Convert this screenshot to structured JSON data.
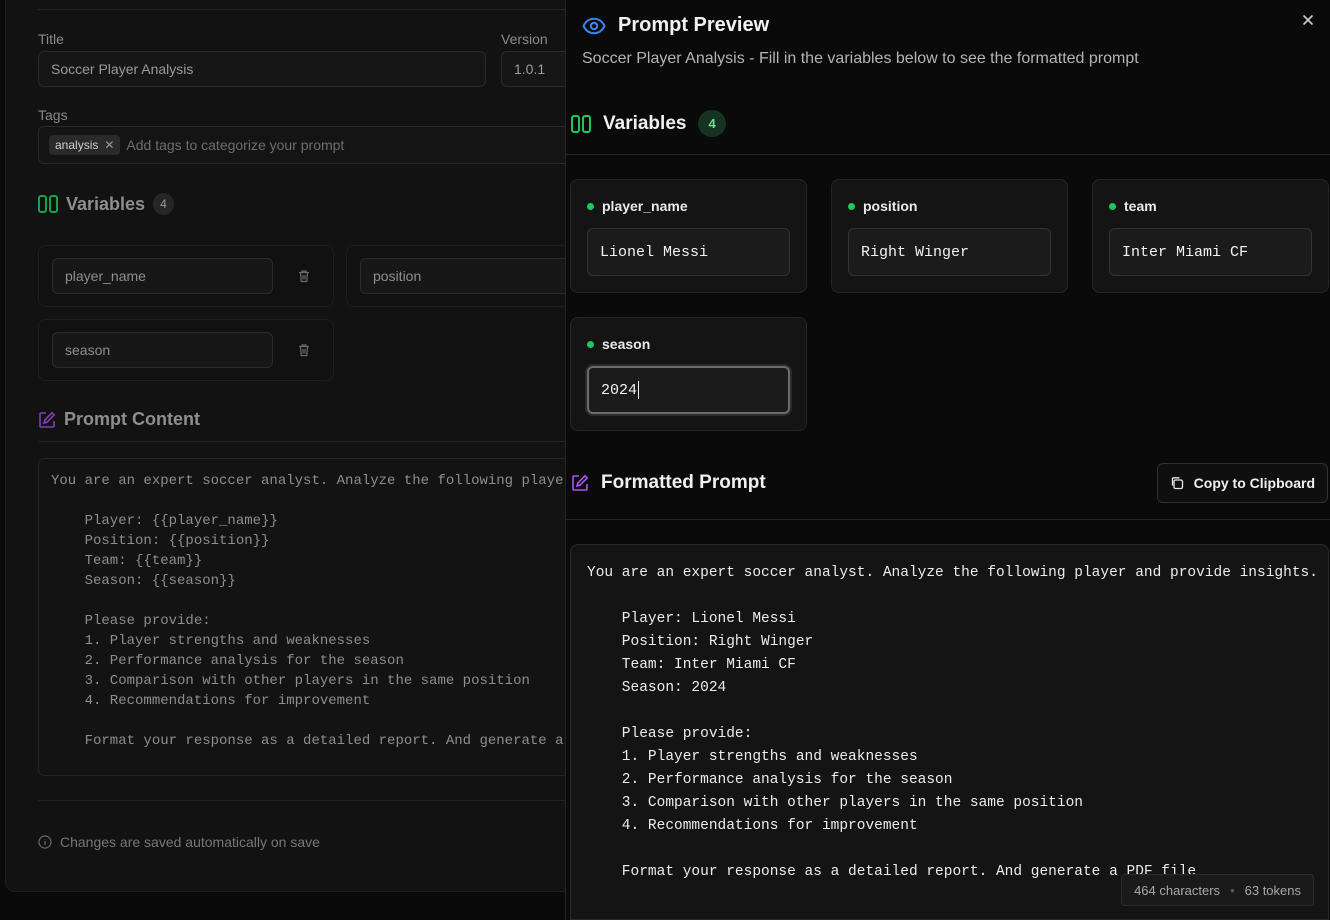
{
  "editor": {
    "title_label": "Title",
    "title_value": "Soccer Player Analysis",
    "version_label": "Version",
    "version_value": "1.0.1",
    "tags_label": "Tags",
    "tags": [
      "analysis"
    ],
    "tags_placeholder": "Add tags to categorize your prompt",
    "variables_heading": "Variables",
    "variables_count": "4",
    "variables": [
      "player_name",
      "position",
      "season"
    ],
    "prompt_heading": "Prompt Content",
    "prompt_text": "You are an expert soccer analyst. Analyze the following playe\n\n    Player: {{player_name}}\n    Position: {{position}}\n    Team: {{team}}\n    Season: {{season}}\n\n    Please provide:\n    1. Player strengths and weaknesses\n    2. Performance analysis for the season\n    3. Comparison with other players in the same position\n    4. Recommendations for improvement\n\n    Format your response as a detailed report. And generate a",
    "save_note": "Changes are saved automatically on save"
  },
  "preview": {
    "title": "Prompt Preview",
    "subtitle": "Soccer Player Analysis - Fill in the variables below to see the formatted prompt",
    "variables_heading": "Variables",
    "variables_count": "4",
    "variables": [
      {
        "name": "player_name",
        "value": "Lionel Messi"
      },
      {
        "name": "position",
        "value": "Right Winger"
      },
      {
        "name": "team",
        "value": "Inter Miami CF"
      },
      {
        "name": "season",
        "value": "2024"
      }
    ],
    "formatted_heading": "Formatted Prompt",
    "copy_label": "Copy to Clipboard",
    "formatted_text": "You are an expert soccer analyst. Analyze the following player and provide insights.\n\n    Player: Lionel Messi\n    Position: Right Winger\n    Team: Inter Miami CF\n    Season: 2024\n\n    Please provide:\n    1. Player strengths and weaknesses\n    2. Performance analysis for the season\n    3. Comparison with other players in the same position\n    4. Recommendations for improvement\n\n    Format your response as a detailed report. And generate a PDF file",
    "characters": "464 characters",
    "tokens": "63 tokens"
  },
  "colors": {
    "accent_blue": "#3b82f6",
    "accent_green": "#22c55e",
    "accent_purple": "#a855f7"
  },
  "icons": [
    "eye-icon",
    "close-icon",
    "columns-icon",
    "edit-icon",
    "copy-icon",
    "trash-icon",
    "info-icon"
  ]
}
